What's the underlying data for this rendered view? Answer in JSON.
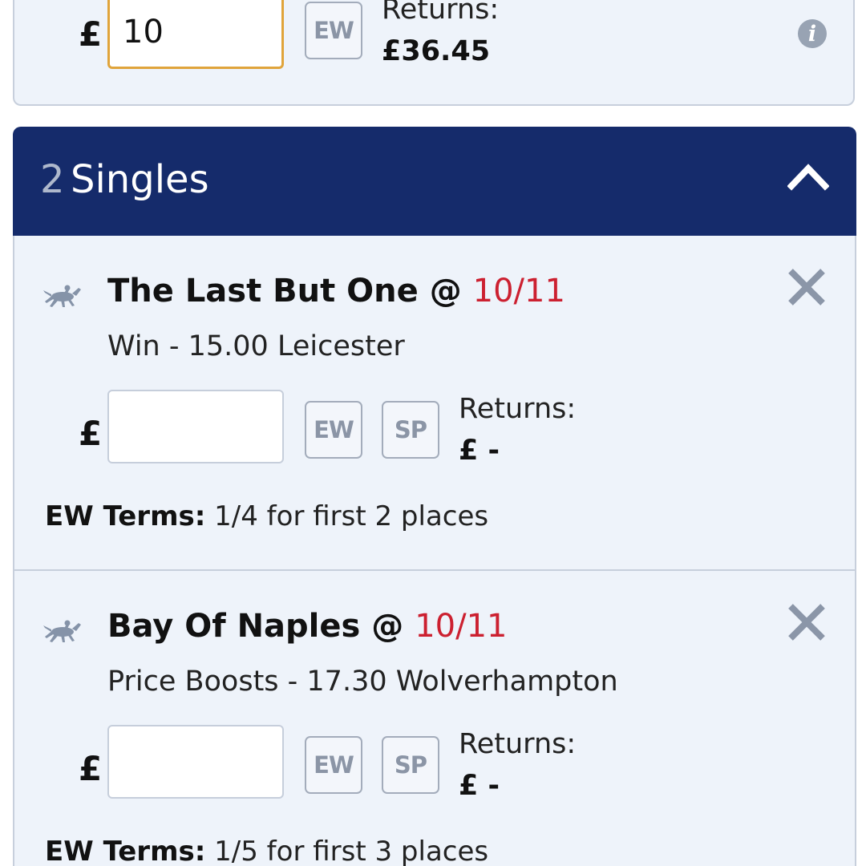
{
  "top_bet": {
    "currency": "£",
    "stake_value": "10",
    "ew_label": "EW",
    "returns_label": "Returns:",
    "returns_value": "£36.45",
    "info_icon": "info-icon"
  },
  "section": {
    "count": "2",
    "title": "Singles",
    "toggle_icon": "chevron-up-icon"
  },
  "singles": [
    {
      "selection": "The Last But One @",
      "odds": "10/11",
      "market": "Win - 15.00 Leicester",
      "currency": "£",
      "stake_value": "",
      "ew_label": "EW",
      "sp_label": "SP",
      "returns_label": "Returns:",
      "returns_value": "£ -",
      "ew_terms_label": "EW Terms:",
      "ew_terms_value": "1/4 for first 2 places"
    },
    {
      "selection": "Bay Of Naples @",
      "odds": "10/11",
      "market": "Price Boosts - 17.30 Wolverhampton",
      "currency": "£",
      "stake_value": "",
      "ew_label": "EW",
      "sp_label": "SP",
      "returns_label": "Returns:",
      "returns_value": "£ -",
      "ew_terms_label": "EW Terms:",
      "ew_terms_value": "1/5 for first 3 places"
    }
  ],
  "colors": {
    "header_bg": "#152b6b",
    "card_bg": "#eef3fa",
    "odds": "#cc2030",
    "active_input_border": "#e0a43b"
  }
}
